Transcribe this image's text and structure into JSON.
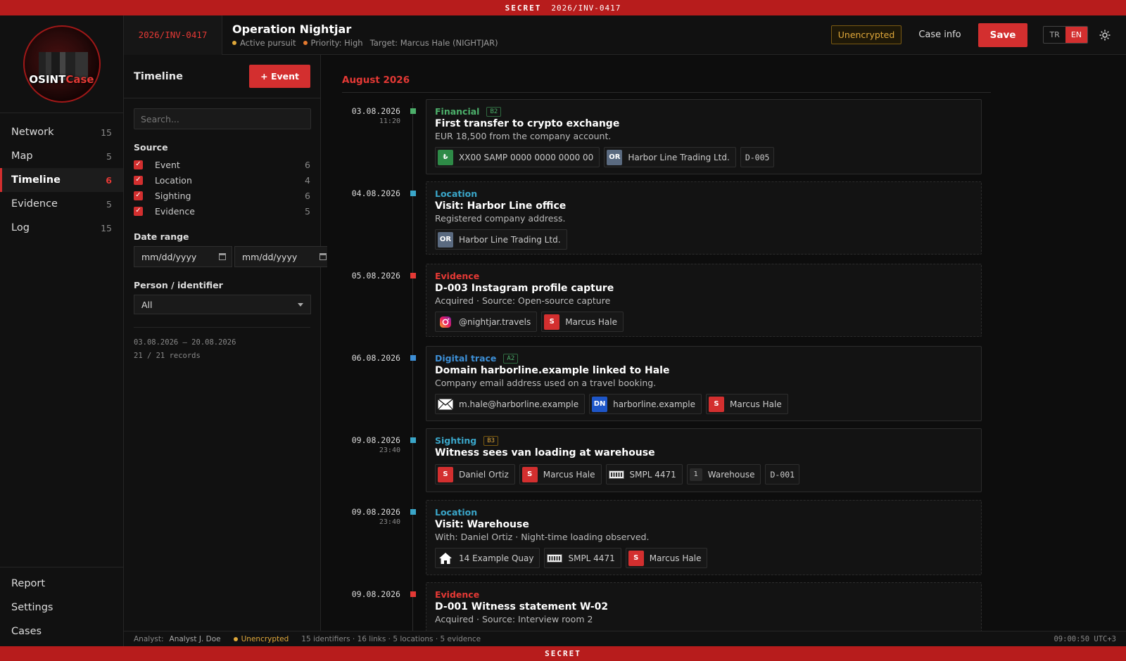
{
  "classification": {
    "top": "SECRET",
    "case_code": "2026/INV-0417",
    "bottom": "SECRET"
  },
  "logo": {
    "part1": "OSINT",
    "part2": "Case"
  },
  "nav": {
    "items": [
      {
        "label": "Network",
        "count": "15"
      },
      {
        "label": "Map",
        "count": "5"
      },
      {
        "label": "Timeline",
        "count": "6"
      },
      {
        "label": "Evidence",
        "count": "5"
      },
      {
        "label": "Log",
        "count": "15"
      }
    ],
    "bottom": [
      {
        "label": "Report"
      },
      {
        "label": "Settings"
      },
      {
        "label": "Cases"
      }
    ]
  },
  "header": {
    "case_code": "2026/INV-0417",
    "title": "Operation Nightjar",
    "status": "Active pursuit",
    "priority": "Priority: High",
    "target": "Target: Marcus Hale (NIGHTJAR)",
    "encryption": "Unencrypted",
    "case_info": "Case info",
    "save": "Save",
    "lang_tr": "TR",
    "lang_en": "EN"
  },
  "panel": {
    "title": "Timeline",
    "add_button": "+ Event",
    "search_placeholder": "Search...",
    "source_label": "Source",
    "sources": [
      {
        "label": "Event",
        "count": "6"
      },
      {
        "label": "Location",
        "count": "4"
      },
      {
        "label": "Sighting",
        "count": "6"
      },
      {
        "label": "Evidence",
        "count": "5"
      }
    ],
    "date_label": "Date range",
    "date_from": "mm/dd/yyyy",
    "date_to": "mm/dd/yyyy",
    "person_label": "Person / identifier",
    "person_value": "All",
    "range": "03.08.2026 – 20.08.2026",
    "records": "21 / 21 records"
  },
  "colors": {
    "accent": "#d32f2f",
    "financial": "#4caf6a",
    "location": "#3aa6c9",
    "evidence": "#e53935",
    "digital": "#3d8fd6",
    "sighting": "#3aa6c9"
  },
  "timeline": {
    "month": "August 2026",
    "events": [
      {
        "date": "03.08.2026",
        "time": "11:20",
        "category": "Financial",
        "badge": "B2",
        "title": "First transfer to crypto exchange",
        "desc": "EUR 18,500 from the company account.",
        "chips": [
          "XX00 SAMP 0000 0000 0000 00",
          "Harbor Line Trading Ltd.",
          "D-005"
        ]
      },
      {
        "date": "04.08.2026",
        "time": "",
        "category": "Location",
        "badge": "",
        "title": "Visit: Harbor Line office",
        "desc": "Registered company address.",
        "chips": [
          "Harbor Line Trading Ltd."
        ]
      },
      {
        "date": "05.08.2026",
        "time": "",
        "category": "Evidence",
        "badge": "",
        "title": "D-003 Instagram profile capture",
        "desc": "Acquired · Source: Open-source capture",
        "chips": [
          "@nightjar.travels",
          "Marcus Hale"
        ]
      },
      {
        "date": "06.08.2026",
        "time": "",
        "category": "Digital trace",
        "badge": "A2",
        "title": "Domain harborline.example linked to Hale",
        "desc": "Company email address used on a travel booking.",
        "chips": [
          "m.hale@harborline.example",
          "harborline.example",
          "Marcus Hale"
        ]
      },
      {
        "date": "09.08.2026",
        "time": "23:40",
        "category": "Sighting",
        "badge": "B3",
        "title": "Witness sees van loading at warehouse",
        "desc": "",
        "chips": [
          "Daniel Ortiz",
          "Marcus Hale",
          "SMPL 4471",
          "Warehouse",
          "D-001"
        ]
      },
      {
        "date": "09.08.2026",
        "time": "23:40",
        "category": "Location",
        "badge": "",
        "title": "Visit: Warehouse",
        "desc": "With: Daniel Ortiz · Night-time loading observed.",
        "chips": [
          "14 Example Quay",
          "SMPL 4471",
          "Marcus Hale"
        ]
      },
      {
        "date": "09.08.2026",
        "time": "",
        "category": "Evidence",
        "badge": "",
        "title": "D-001 Witness statement W-02",
        "desc": "Acquired · Source: Interview room 2",
        "chips": []
      }
    ]
  },
  "chip_icons": {
    "or": "OR",
    "s": "S",
    "dn": "DN",
    "one": "1"
  },
  "footer": {
    "analyst_label": "Analyst:",
    "analyst": "Analyst J. Doe",
    "encryption": "Unencrypted",
    "stats": "15 identifiers · 16 links · 5 locations · 5 evidence",
    "clock": "09:00:50 UTC+3"
  }
}
